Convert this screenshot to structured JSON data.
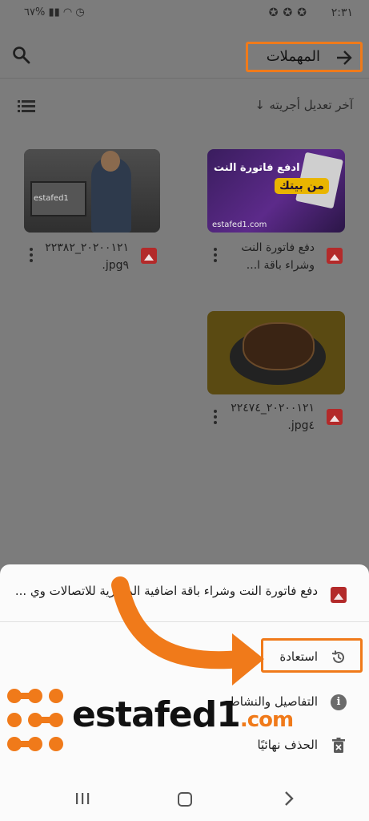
{
  "status_bar": {
    "time": "٢:٣١",
    "battery": "٦٧%",
    "icons": [
      "signal-icon",
      "wifi-icon",
      "alarm-icon",
      "notification-icon"
    ]
  },
  "toolbar": {
    "title": "المهملات",
    "back_icon": "arrow-right-icon",
    "search_icon": "search-icon"
  },
  "sort": {
    "label": "آخر تعديل أجريته",
    "direction_icon": "arrow-down-icon",
    "view_icon": "list-view-icon"
  },
  "files": [
    {
      "name_line1": "دفع فاتورة النت",
      "name_line2": "وشراء باقة ا...",
      "thumb_text1": "ادفع فاتورة النت",
      "thumb_text2": "من بيتك",
      "thumb_site": "estafed1.com"
    },
    {
      "name_line1": "٢٠٢٠٠١٢١_٢٢٣٨٢",
      "name_line2": "jpg٩.",
      "thumb_text1": "estafed1"
    },
    {
      "name_line1": "٢٠٢٠٠١٢١_٢٢٤٧٤",
      "name_line2": "jpg٤."
    }
  ],
  "sheet": {
    "title": "دفع فاتورة النت وشراء باقة اضافية المصرية للاتصالات وي ...",
    "actions": [
      {
        "label": "استعادة",
        "icon": "restore-icon"
      },
      {
        "label": "التفاصيل والنشاط",
        "icon": "info-icon"
      },
      {
        "label": "الحذف نهائيًا",
        "icon": "delete-forever-icon"
      }
    ]
  },
  "navbar": {
    "recent_icon": "recent-apps-icon",
    "home_icon": "home-icon",
    "back_icon": "back-icon"
  },
  "watermark": {
    "brand": "estafed1",
    "tld": ".com"
  },
  "colors": {
    "highlight": "#f07a1a",
    "dim_overlay": "#7c7c7c",
    "file_icon": "#b32a2a",
    "sheet_bg": "#fbfbfb"
  }
}
